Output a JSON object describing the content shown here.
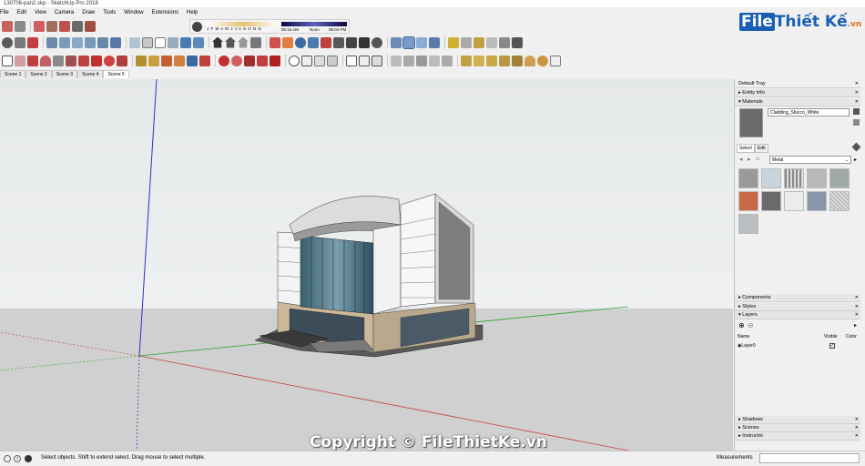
{
  "window": {
    "title": "130706-pan2.skp - SketchUp Pro 2018"
  },
  "menu": [
    "File",
    "Edit",
    "View",
    "Camera",
    "Draw",
    "Tools",
    "Window",
    "Extensions",
    "Help"
  ],
  "shadow_widget": {
    "months": "J F M A M J J A S O N D",
    "time_start": "06:15 AM",
    "noon": "Noon",
    "time_end": "06:04 PM"
  },
  "scenes": [
    {
      "label": "Scene 1",
      "active": false
    },
    {
      "label": "Scene 2",
      "active": false
    },
    {
      "label": "Scene 3",
      "active": false
    },
    {
      "label": "Scene 4",
      "active": false
    },
    {
      "label": "Scene 5",
      "active": true
    }
  ],
  "tray": {
    "title": "Default Tray",
    "entity_info": "Entity Info",
    "materials": "Materials",
    "material_name": "Cladding_Stucco_White",
    "tab_select": "Select",
    "tab_edit": "Edit",
    "library": "Metal",
    "components": "Components",
    "styles": "Styles",
    "layers": "Layers",
    "layer_col_name": "Name",
    "layer_col_visible": "Visible",
    "layer_col_color": "Color",
    "layer_name": "Layer0",
    "shadows": "Shadows",
    "scenes": "Scenes",
    "instructor": "Instructor"
  },
  "status": {
    "text": "Select objects. Shift to extend select. Drag mouse to select multiple.",
    "measurements_label": "Measurements"
  },
  "watermark": "Copyright © FileThietKe.vn",
  "logo": {
    "file": "File",
    "brand": "Thiết Kế",
    "suffix": ".vn"
  },
  "colors": {
    "accent": "#1a5fb4",
    "sky": "#e9eced",
    "ground": "#cfcfcf",
    "axis_red": "#c84040",
    "axis_green": "#2aa42a",
    "axis_blue": "#3030c0"
  }
}
